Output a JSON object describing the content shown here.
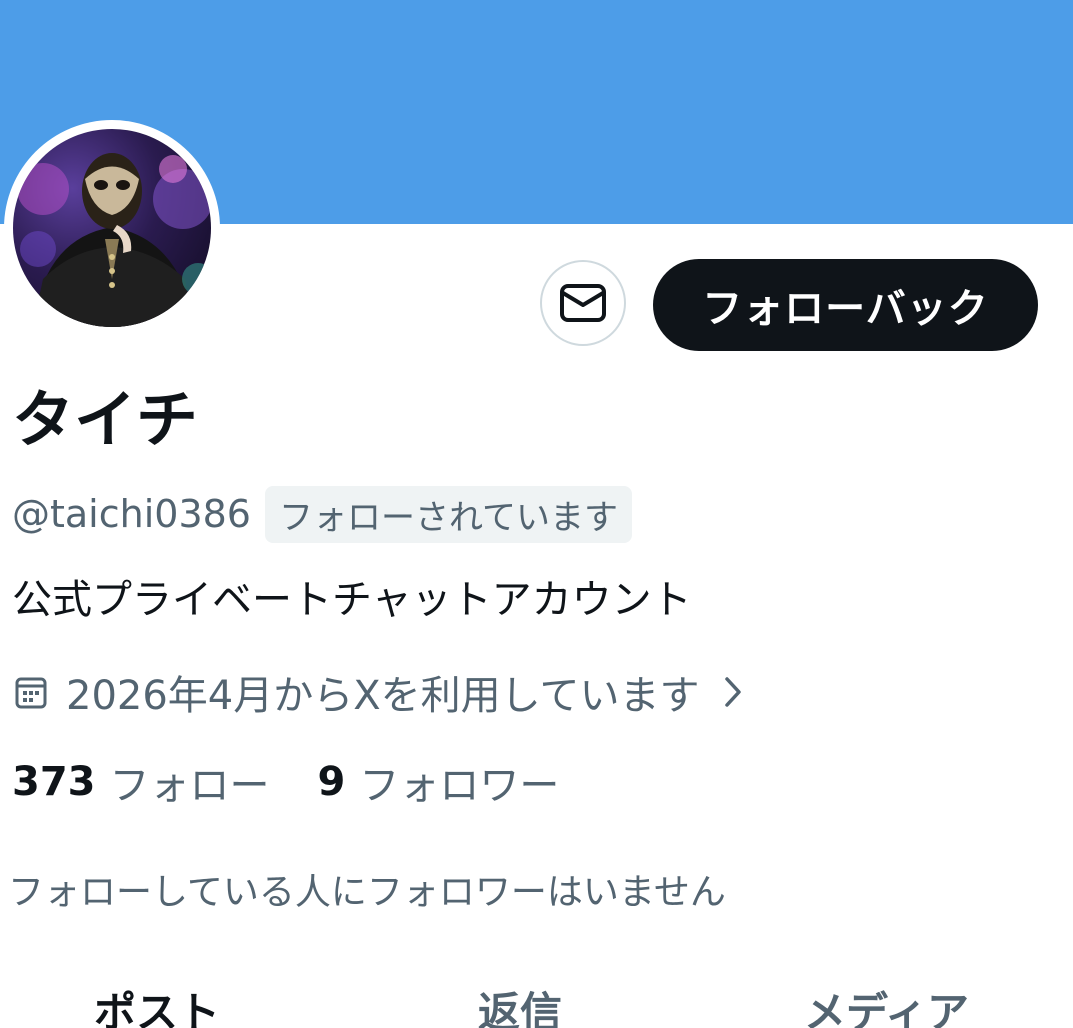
{
  "profile": {
    "display_name": "タイチ",
    "handle": "@taichi0386",
    "follows_you_badge": "フォローされています",
    "bio": "公式プライベートチャットアカウント",
    "joined": "2026年4月からXを利用しています",
    "following_count": "373",
    "following_label": "フォロー",
    "followers_count": "9",
    "followers_label": "フォロワー",
    "mutual_note": "フォローしている人にフォロワーはいません"
  },
  "actions": {
    "follow_back_label": "フォローバック",
    "message_icon": "mail-icon"
  },
  "tabs": [
    {
      "label": "ポスト",
      "active": true
    },
    {
      "label": "返信",
      "active": false
    },
    {
      "label": "メディア",
      "active": false
    }
  ],
  "colors": {
    "banner": "#4d9de8",
    "primary_text": "#0f1419",
    "secondary_text": "#536471",
    "button_dark": "#0f1419",
    "badge_bg": "#eff3f4"
  }
}
